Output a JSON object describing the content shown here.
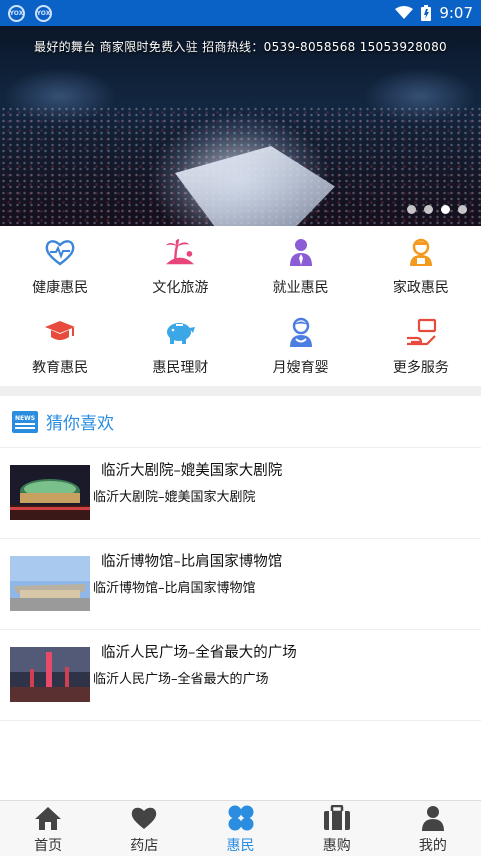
{
  "status_bar": {
    "time": "9:07",
    "left_badges": [
      "YOX",
      "YOX"
    ]
  },
  "banner": {
    "subtitle": "最好的舞台 商家限时免费入驻 招商热线：0539-8058568 15053928080",
    "dots": 4,
    "active_dot": 3
  },
  "categories": [
    {
      "label": "健康惠民",
      "icon": "heart-pulse-icon",
      "color": "#3b86d8"
    },
    {
      "label": "文化旅游",
      "icon": "palm-tree-icon",
      "color": "#e8457a"
    },
    {
      "label": "就业惠民",
      "icon": "person-tie-icon",
      "color": "#8b5cd6"
    },
    {
      "label": "家政惠民",
      "icon": "housekeeper-icon",
      "color": "#f39a1e"
    },
    {
      "label": "教育惠民",
      "icon": "graduation-cap-icon",
      "color": "#e84a3d"
    },
    {
      "label": "惠民理财",
      "icon": "piggy-bank-icon",
      "color": "#3ca7e6"
    },
    {
      "label": "月嫂育婴",
      "icon": "nanny-icon",
      "color": "#4c7de0"
    },
    {
      "label": "更多服务",
      "icon": "hand-service-icon",
      "color": "#e84a3d"
    }
  ],
  "section": {
    "title": "猜你喜欢",
    "icon": "news-icon"
  },
  "list_items": [
    {
      "title": "临沂大剧院–媲美国家大剧院",
      "subtitle": "临沂大剧院–媲美国家大剧院",
      "thumb": "theater"
    },
    {
      "title": "临沂博物馆–比肩国家博物馆",
      "subtitle": "临沂博物馆–比肩国家博物馆",
      "thumb": "museum"
    },
    {
      "title": "临沂人民广场–全省最大的广场",
      "subtitle": "临沂人民广场–全省最大的广场",
      "thumb": "square"
    }
  ],
  "tabs": [
    {
      "label": "首页",
      "icon": "home-icon",
      "active": false
    },
    {
      "label": "药店",
      "icon": "heart-icon",
      "active": false
    },
    {
      "label": "惠民",
      "icon": "clover-icon",
      "active": true
    },
    {
      "label": "惠购",
      "icon": "briefcase-icon",
      "active": false
    },
    {
      "label": "我的",
      "icon": "user-icon",
      "active": false
    }
  ],
  "colors": {
    "accent": "#2a8de0",
    "status_bar": "#0b62c6"
  }
}
